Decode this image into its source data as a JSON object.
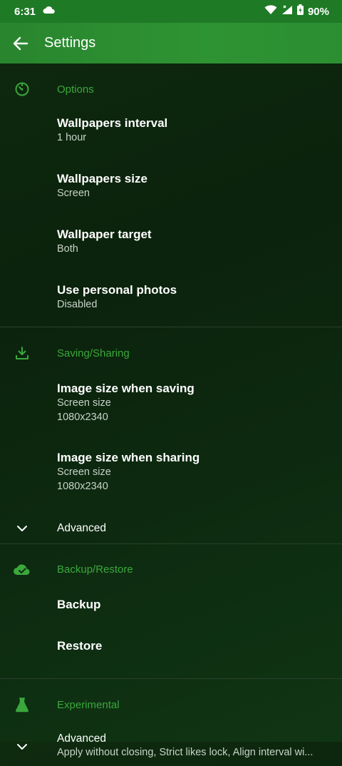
{
  "status_bar": {
    "time": "6:31",
    "battery": "90%"
  },
  "app_bar": {
    "title": "Settings"
  },
  "sections": {
    "options": {
      "title": "Options",
      "items": [
        {
          "title": "Wallpapers interval",
          "summary": "1 hour"
        },
        {
          "title": "Wallpapers size",
          "summary": "Screen"
        },
        {
          "title": "Wallpaper target",
          "summary": "Both"
        },
        {
          "title": "Use personal photos",
          "summary": "Disabled"
        }
      ]
    },
    "saving": {
      "title": "Saving/Sharing",
      "items": [
        {
          "title": "Image size when saving",
          "summary": "Screen size",
          "detail": "1080x2340"
        },
        {
          "title": "Image size when sharing",
          "summary": "Screen size",
          "detail": "1080x2340"
        }
      ],
      "advanced_label": "Advanced"
    },
    "backup": {
      "title": "Backup/Restore",
      "items": [
        {
          "title": "Backup"
        },
        {
          "title": "Restore"
        }
      ]
    },
    "experimental": {
      "title": "Experimental",
      "advanced_label": "Advanced",
      "advanced_summary": "Apply without closing, Strict likes lock, Align interval wi..."
    }
  },
  "colors": {
    "accent": "#3aa83c",
    "app_bar": "#2e9333",
    "status_bar": "#1f7a26"
  },
  "icons": {
    "options": "timer-icon",
    "saving": "download-icon",
    "backup": "cloud-check-icon",
    "experimental": "flask-icon"
  }
}
